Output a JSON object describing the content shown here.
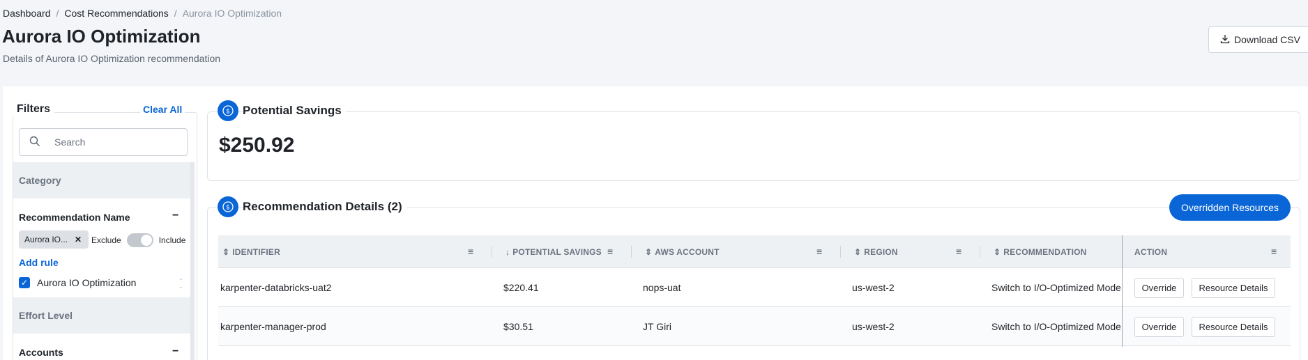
{
  "breadcrumb": {
    "items": [
      "Dashboard",
      "Cost Recommendations"
    ],
    "current": "Aurora IO Optimization",
    "separator": "/"
  },
  "header": {
    "title": "Aurora IO Optimization",
    "subtitle": "Details of Aurora IO Optimization recommendation",
    "download_label": "Download CSV"
  },
  "filters": {
    "title": "Filters",
    "clear_all": "Clear All",
    "search_placeholder": "Search",
    "category_label": "Category",
    "recommendation_name": {
      "title": "Recommendation Name",
      "chip": "Aurora IO...",
      "exclude": "Exclude",
      "include": "Include",
      "add_rule": "Add rule",
      "option": "Aurora IO Optimization"
    },
    "effort_level_label": "Effort Level",
    "accounts_label": "Accounts"
  },
  "savings": {
    "title": "Potential Savings",
    "value": "$250.92"
  },
  "details": {
    "title": "Recommendation Details (2)",
    "overridden_label": "Overridden Resources",
    "columns": [
      "IDENTIFIER",
      "POTENTIAL SAVINGS",
      "AWS ACCOUNT",
      "REGION",
      "RECOMMENDATION",
      "ACTION"
    ],
    "rows": [
      {
        "identifier": "karpenter-databricks-uat2",
        "savings": "$220.41",
        "account": "nops-uat",
        "region": "us-west-2",
        "recommendation": "Switch to I/O-Optimized Mode"
      },
      {
        "identifier": "karpenter-manager-prod",
        "savings": "$30.51",
        "account": "JT Giri",
        "region": "us-west-2",
        "recommendation": "Switch to I/O-Optimized Mode"
      }
    ],
    "override_label": "Override",
    "resource_details_label": "Resource Details"
  },
  "colors": {
    "accent": "#0a66d6",
    "page_bg": "#f3f5f8"
  }
}
